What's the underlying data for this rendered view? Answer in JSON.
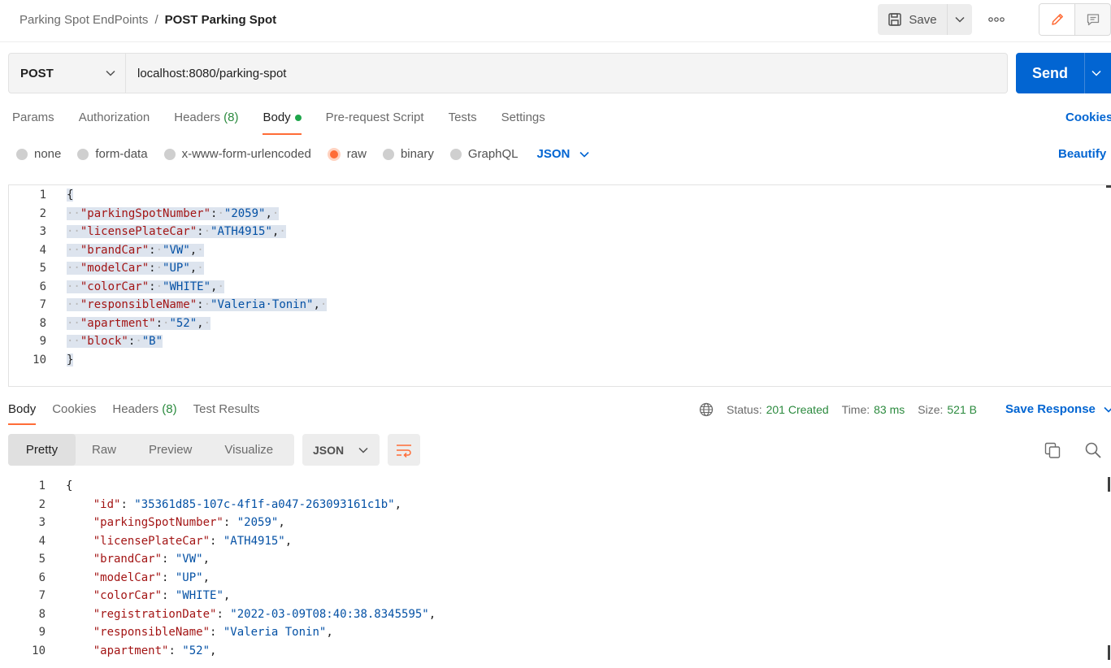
{
  "breadcrumb": {
    "parent": "Parking Spot EndPoints",
    "separator": "/",
    "current": "POST Parking Spot"
  },
  "toolbar": {
    "save_label": "Save"
  },
  "request": {
    "method": "POST",
    "url": "localhost:8080/parking-spot",
    "send_label": "Send"
  },
  "request_tabs": {
    "params": "Params",
    "authorization": "Authorization",
    "headers": "Headers",
    "headers_count": "(8)",
    "body": "Body",
    "prerequest": "Pre-request Script",
    "tests": "Tests",
    "settings": "Settings",
    "cookies": "Cookies"
  },
  "body_types": {
    "none": "none",
    "form_data": "form-data",
    "urlencoded": "x-www-form-urlencoded",
    "raw": "raw",
    "binary": "binary",
    "graphql": "GraphQL",
    "format": "JSON",
    "beautify": "Beautify"
  },
  "request_body_lines": [
    {
      "n": "1",
      "key": "",
      "val": "",
      "open": "{"
    },
    {
      "n": "2",
      "key": "\"parkingSpotNumber\"",
      "val": "\"2059\""
    },
    {
      "n": "3",
      "key": "\"licensePlateCar\"",
      "val": "\"ATH4915\""
    },
    {
      "n": "4",
      "key": "\"brandCar\"",
      "val": "\"VW\""
    },
    {
      "n": "5",
      "key": "\"modelCar\"",
      "val": "\"UP\""
    },
    {
      "n": "6",
      "key": "\"colorCar\"",
      "val": "\"WHITE\""
    },
    {
      "n": "7",
      "key": "\"responsibleName\"",
      "val": "\"Valeria Tonin\""
    },
    {
      "n": "8",
      "key": "\"apartment\"",
      "val": "\"52\""
    },
    {
      "n": "9",
      "key": "\"block\"",
      "val": "\"B\""
    },
    {
      "n": "10",
      "key": "",
      "val": "",
      "open": "}"
    }
  ],
  "response_tabs": {
    "body": "Body",
    "cookies": "Cookies",
    "headers": "Headers",
    "headers_count": "(8)",
    "test_results": "Test Results"
  },
  "response_meta": {
    "status_label": "Status:",
    "status_value": "201 Created",
    "time_label": "Time:",
    "time_value": "83 ms",
    "size_label": "Size:",
    "size_value": "521 B",
    "save_response": "Save Response"
  },
  "response_view": {
    "pretty": "Pretty",
    "raw": "Raw",
    "preview": "Preview",
    "visualize": "Visualize",
    "format": "JSON"
  },
  "response_body_lines": [
    {
      "n": "1",
      "key": "",
      "val": "",
      "open": "{"
    },
    {
      "n": "2",
      "key": "\"id\"",
      "val": "\"35361d85-107c-4f1f-a047-263093161c1b\""
    },
    {
      "n": "3",
      "key": "\"parkingSpotNumber\"",
      "val": "\"2059\""
    },
    {
      "n": "4",
      "key": "\"licensePlateCar\"",
      "val": "\"ATH4915\""
    },
    {
      "n": "5",
      "key": "\"brandCar\"",
      "val": "\"VW\""
    },
    {
      "n": "6",
      "key": "\"modelCar\"",
      "val": "\"UP\""
    },
    {
      "n": "7",
      "key": "\"colorCar\"",
      "val": "\"WHITE\""
    },
    {
      "n": "8",
      "key": "\"registrationDate\"",
      "val": "\"2022-03-09T08:40:38.8345595\""
    },
    {
      "n": "9",
      "key": "\"responsibleName\"",
      "val": "\"Valeria Tonin\""
    },
    {
      "n": "10",
      "key": "\"apartment\"",
      "val": "\"52\""
    }
  ],
  "colors": {
    "accent": "#ff6c37",
    "primary": "#0265d2",
    "success": "#2b8a3e"
  }
}
